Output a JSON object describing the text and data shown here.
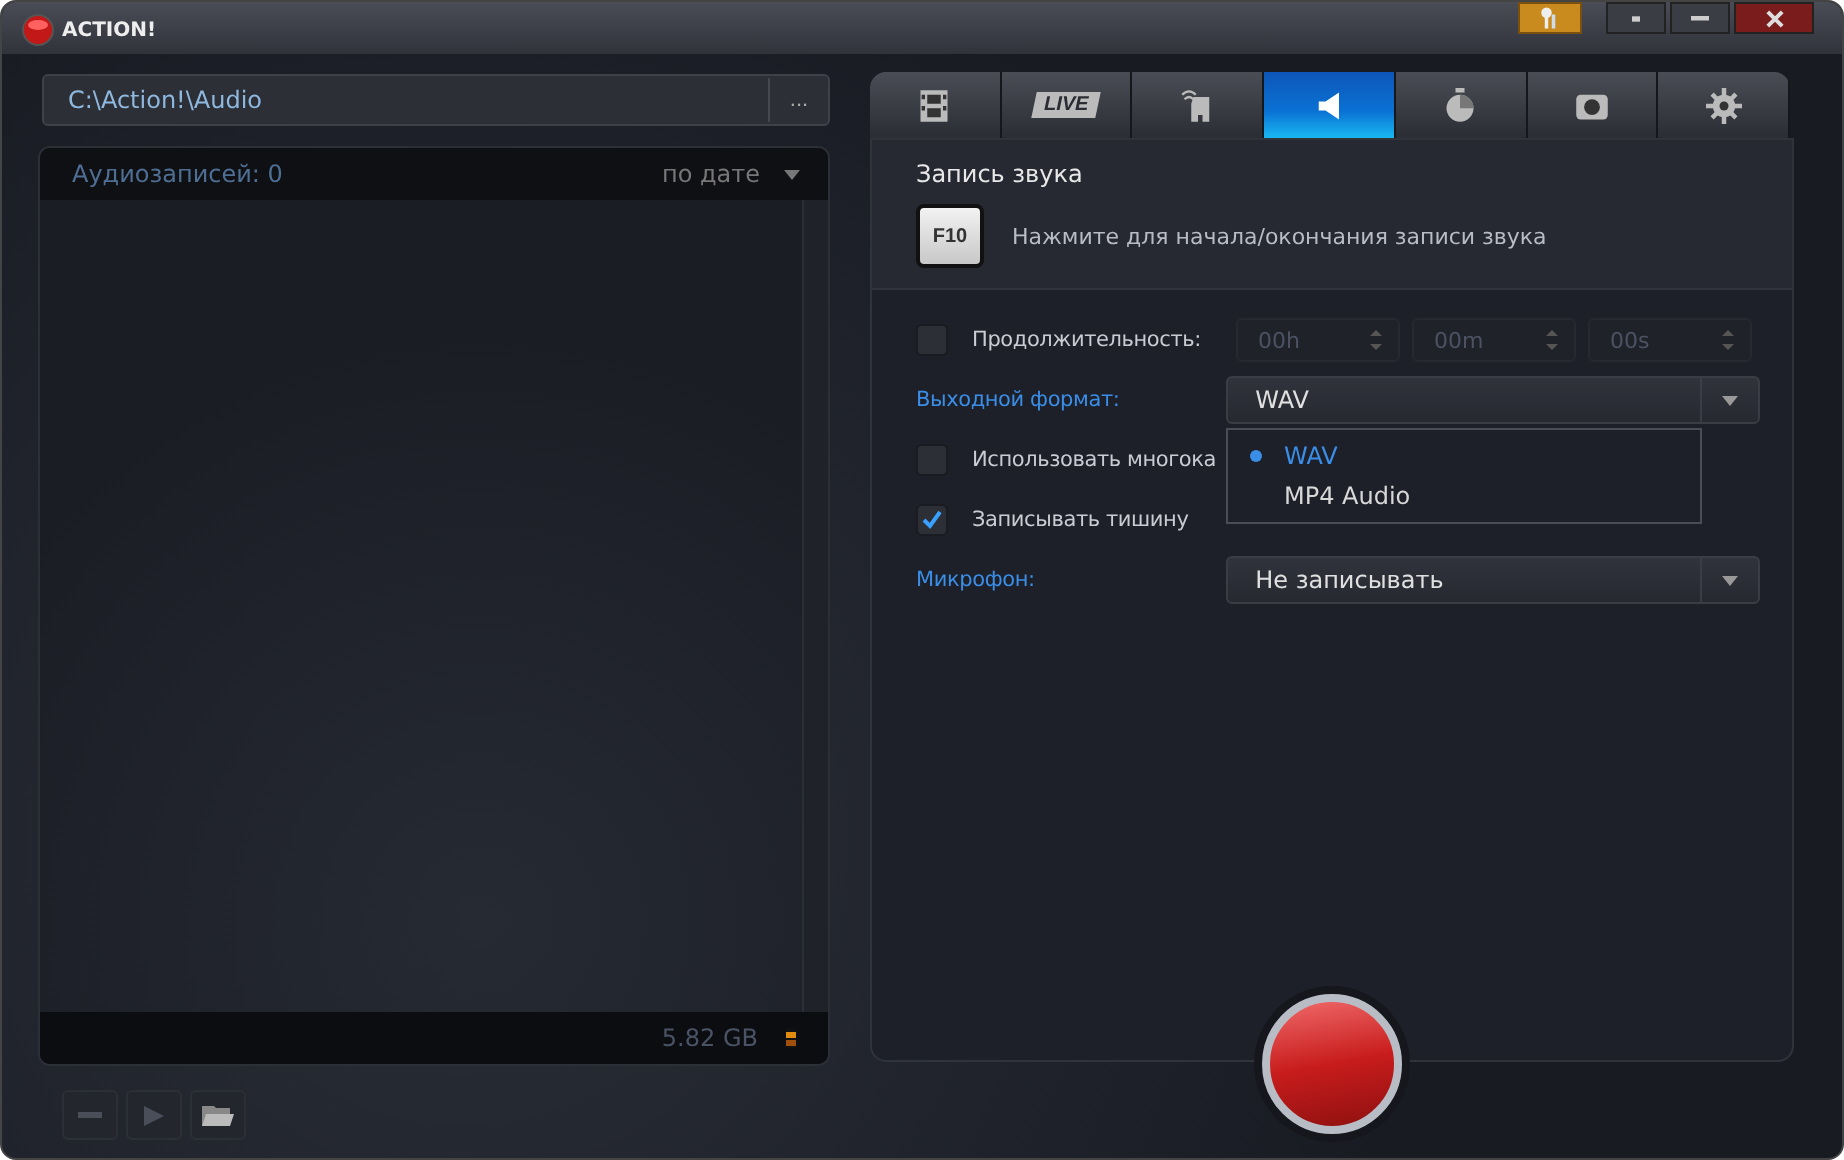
{
  "window": {
    "title": "ACTION!"
  },
  "left": {
    "path": "C:\\Action!\\Audio",
    "browse": "...",
    "count_label": "Аудиозаписей: 0",
    "sort": "по дате",
    "disk_free": "5.82 GB"
  },
  "tabs": [
    {
      "kind": "film",
      "selected": false
    },
    {
      "kind": "live",
      "label": "LIVE",
      "selected": false
    },
    {
      "kind": "game",
      "selected": false
    },
    {
      "kind": "speaker",
      "selected": true
    },
    {
      "kind": "timer",
      "selected": false
    },
    {
      "kind": "camera",
      "selected": false
    },
    {
      "kind": "gear",
      "selected": false
    }
  ],
  "panel": {
    "title": "Запись звука",
    "hotkey": "F10",
    "hotkey_hint": "Нажмите для начала/окончания записи звука",
    "duration": {
      "label": "Продолжительность:",
      "checked": false,
      "fields": [
        "00h",
        "00m",
        "00s"
      ]
    },
    "format": {
      "label": "Выходной формат:",
      "value": "WAV",
      "options": [
        {
          "label": "WAV",
          "selected": true
        },
        {
          "label": "MP4 Audio",
          "selected": false
        }
      ]
    },
    "multichannel": {
      "label": "Использовать многока",
      "checked": false
    },
    "silence": {
      "label": "Записывать тишину",
      "checked": true
    },
    "microphone": {
      "label": "Микрофон:",
      "value": "Не записывать"
    }
  }
}
